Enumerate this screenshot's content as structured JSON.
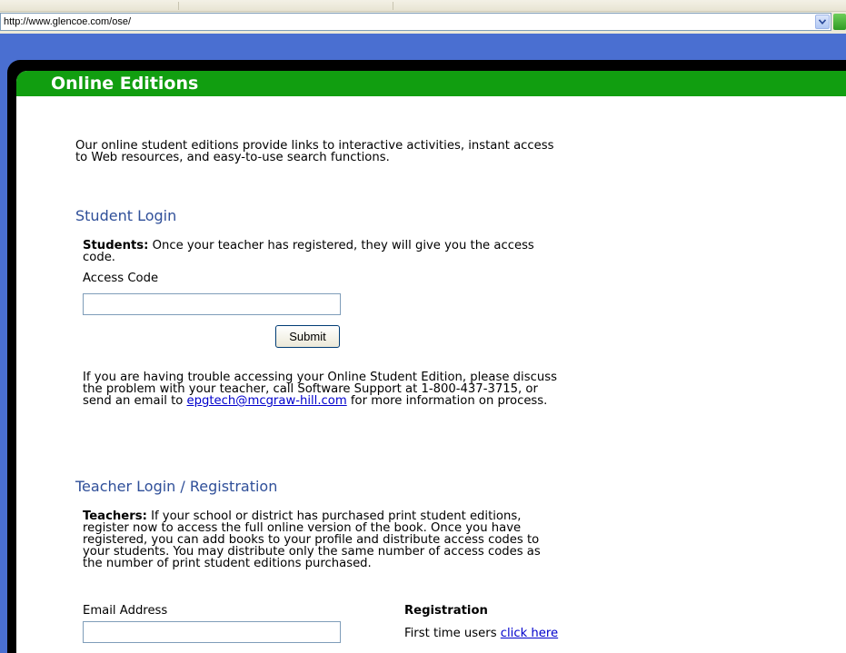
{
  "browser": {
    "address": "http://www.glencoe.com/ose/"
  },
  "header": {
    "title": "Online Editions"
  },
  "intro": {
    "line1": "Our online student editions provide links to interactive activities, instant access",
    "line2": "to Web resources, and easy-to-use search functions."
  },
  "student_login": {
    "heading": "Student Login",
    "lead_bold": "Students:",
    "lead_rest_line1": " Once your teacher has registered, they will give you the access",
    "line2": "code.",
    "access_label": "Access Code",
    "access_value": "",
    "submit_label": "Submit",
    "help_line1": "If you are having trouble accessing your Online Student Edition, please discuss",
    "help_line2": "the problem with your teacher, call Software Support at 1-800-437-3715, or",
    "help_line3_pre": "send an email to ",
    "help_email": "epgtech@mcgraw-hill.com",
    "help_line3_post": " for more information on process."
  },
  "teacher_login": {
    "heading": "Teacher Login / Registration",
    "lead_bold": "Teachers:",
    "lead_rest_line1": " If your school or district has purchased print student editions,",
    "line2": "register now to access the full online version of the book. Once you have",
    "line3": "registered, you can add books to your profile and distribute access codes to",
    "line4": "your students. You may distribute only the same number of access codes as",
    "line5": "the number of print student editions purchased.",
    "email_label": "Email Address",
    "email_value": "",
    "registration_heading": "Registration",
    "first_time_text": "First time users ",
    "click_here": "click here"
  },
  "colors": {
    "header_green": "#119e10",
    "page_blue": "#4a6fd1",
    "heading_blue": "#2f4f99",
    "link_blue": "#0000cc"
  }
}
